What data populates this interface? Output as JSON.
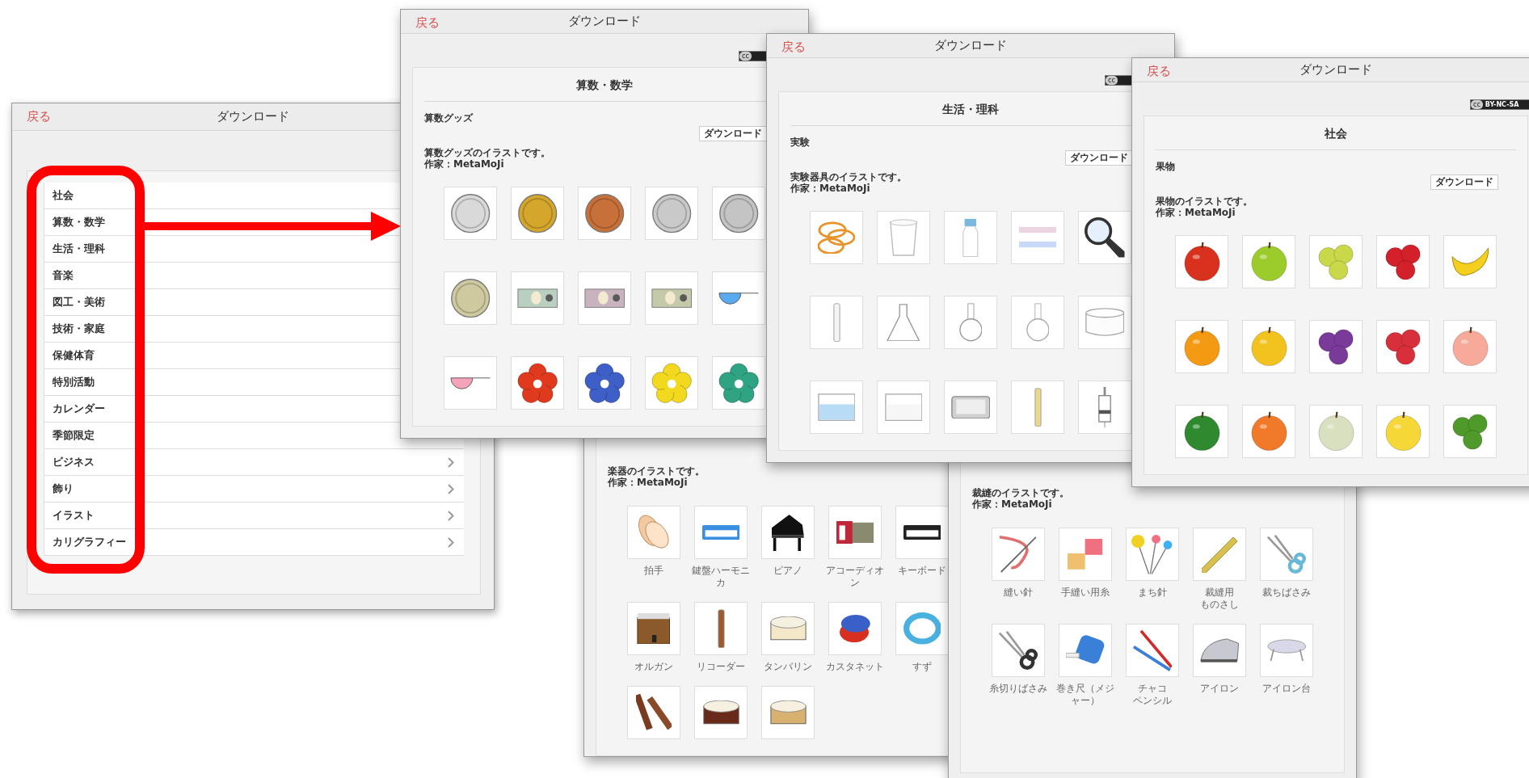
{
  "list_window": {
    "back": "戻る",
    "title": "ダウンロード",
    "items": [
      {
        "label": "社会",
        "chevron": false
      },
      {
        "label": "算数・数学",
        "chevron": false
      },
      {
        "label": "生活・理科",
        "chevron": false
      },
      {
        "label": "音楽",
        "chevron": false
      },
      {
        "label": "図工・美術",
        "chevron": false
      },
      {
        "label": "技術・家庭",
        "chevron": false
      },
      {
        "label": "保健体育",
        "chevron": false
      },
      {
        "label": "特別活動",
        "chevron": false
      },
      {
        "label": "カレンダー",
        "chevron": false
      },
      {
        "label": "季節限定",
        "chevron": false
      },
      {
        "label": "ビジネス",
        "chevron": true
      },
      {
        "label": "飾り",
        "chevron": true
      },
      {
        "label": "イラスト",
        "chevron": true
      },
      {
        "label": "カリグラフィー",
        "chevron": true
      }
    ]
  },
  "windows": [
    {
      "back": "戻る",
      "title": "ダウンロード",
      "license": {
        "mark": "cc"
      },
      "category": "算数・数学",
      "section": "算数グッズ",
      "download": "ダウンロード",
      "description": "算数グッズのイラストです。",
      "author": "作家：MetaMoJi",
      "tiles": [
        {
          "kind": "coin",
          "color": "#d9d9d9"
        },
        {
          "kind": "coin",
          "color": "#d4a72c"
        },
        {
          "kind": "coin",
          "color": "#c8703a"
        },
        {
          "kind": "coin",
          "color": "#c9c9c9"
        },
        {
          "kind": "coin",
          "color": "#c4c4c4"
        },
        {
          "kind": "coin",
          "color": "#cfc9a0"
        },
        {
          "kind": "bill",
          "color": "#b9cfc0"
        },
        {
          "kind": "bill",
          "color": "#c9b3bf"
        },
        {
          "kind": "bill",
          "color": "#c3c9a9"
        },
        {
          "kind": "scoop",
          "color": "#5aaaf0"
        },
        {
          "kind": "scoop",
          "color": "#f4a3b8"
        },
        {
          "kind": "flower",
          "color": "#e03a1e"
        },
        {
          "kind": "flower",
          "color": "#3f5fc8"
        },
        {
          "kind": "flower",
          "color": "#f2d81e"
        },
        {
          "kind": "flower",
          "color": "#2fa383"
        }
      ]
    },
    {
      "back": "戻る",
      "title": "ダウンロード",
      "license": {
        "mark": "cc"
      },
      "category": "生活・理科",
      "section": "実験",
      "download": "ダウンロード",
      "description": "実験器具のイラストです。",
      "author": "作家：MetaMoJi",
      "tiles": [
        {
          "kind": "bands",
          "color": "#e8922a"
        },
        {
          "kind": "cup",
          "color": "#bbbbbb"
        },
        {
          "kind": "bottle",
          "color": "#7ab8e0"
        },
        {
          "kind": "strips",
          "color": "#c8d8f8"
        },
        {
          "kind": "magnifier",
          "color": "#333333"
        },
        {
          "kind": "stick",
          "color": "#f4f4f4"
        },
        {
          "kind": "flask",
          "color": "#999999"
        },
        {
          "kind": "roundflask",
          "color": "#999999"
        },
        {
          "kind": "roundflask",
          "color": "#aaaaaa"
        },
        {
          "kind": "dish",
          "color": "#aaaaaa"
        },
        {
          "kind": "tank",
          "color": "#b8dcf5"
        },
        {
          "kind": "tank",
          "color": "#f6f6f6"
        },
        {
          "kind": "tray",
          "color": "#d0d0d0"
        },
        {
          "kind": "stick",
          "color": "#e8d890"
        },
        {
          "kind": "syringe",
          "color": "#888888"
        }
      ]
    },
    {
      "back": "戻る",
      "title": "ダウンロード",
      "license": {
        "mark": "cc",
        "label": "BY-NC-SA"
      },
      "category": "社会",
      "section": "果物",
      "download": "ダウンロード",
      "description": "果物のイラストです。",
      "author": "作家：MetaMoJi",
      "tiles": [
        {
          "kind": "fruit",
          "color": "#d8321e"
        },
        {
          "kind": "fruit",
          "color": "#9ccc2c"
        },
        {
          "kind": "berries",
          "color": "#c8d848"
        },
        {
          "kind": "berries",
          "color": "#d4202a"
        },
        {
          "kind": "banana",
          "color": "#f5cf1e"
        },
        {
          "kind": "fruit",
          "color": "#f39a12"
        },
        {
          "kind": "fruit",
          "color": "#f2c21e"
        },
        {
          "kind": "berries",
          "color": "#7a3a9a"
        },
        {
          "kind": "berries",
          "color": "#d8303a"
        },
        {
          "kind": "fruit",
          "color": "#f7a99a"
        },
        {
          "kind": "fruit",
          "color": "#2f8a2f"
        },
        {
          "kind": "fruit",
          "color": "#f07a2a"
        },
        {
          "kind": "fruit",
          "color": "#d8e0c0"
        },
        {
          "kind": "fruit",
          "color": "#f5d838"
        },
        {
          "kind": "berries",
          "color": "#4f9a2a"
        }
      ]
    },
    {
      "description": "楽器のイラストです。",
      "author": "作家：MetaMoJi",
      "tiles": [
        {
          "kind": "hands",
          "color": "#f2c9a0",
          "lines": [
            "拍手"
          ]
        },
        {
          "kind": "keyboard",
          "color": "#3a8fe0",
          "lines": [
            "鍵盤ハーモニカ"
          ]
        },
        {
          "kind": "piano",
          "color": "#111111",
          "lines": [
            "ピアノ"
          ]
        },
        {
          "kind": "accordion",
          "color": "#c0283a",
          "lines": [
            "アコーディオン"
          ]
        },
        {
          "kind": "keyboard",
          "color": "#222222",
          "lines": [
            "キーボード"
          ]
        },
        {
          "kind": "organ",
          "color": "#8a5a2a",
          "lines": [
            "オルガン"
          ]
        },
        {
          "kind": "stick",
          "color": "#9a5a2a",
          "lines": [
            "リコーダー"
          ]
        },
        {
          "kind": "drum",
          "color": "#f5e8c8",
          "lines": [
            "タンバリン"
          ]
        },
        {
          "kind": "castanet",
          "color": "#3a60c8",
          "lines": [
            "カスタネット"
          ]
        },
        {
          "kind": "bellring",
          "color": "#4ab0e0",
          "lines": [
            "すず"
          ]
        },
        {
          "kind": "sticks",
          "color": "#7a3a20"
        },
        {
          "kind": "drum",
          "color": "#6a2a1a"
        },
        {
          "kind": "drum",
          "color": "#d8b070"
        }
      ]
    },
    {
      "description": "裁縫のイラストです。",
      "author": "作家：MetaMoJi",
      "tiles": [
        {
          "kind": "needle",
          "color": "#e07070",
          "lines": [
            "縫い針"
          ]
        },
        {
          "kind": "thread",
          "color": "#f07080",
          "lines": [
            "手縫い用糸"
          ]
        },
        {
          "kind": "pins",
          "color": "#f0d020",
          "lines": [
            "まち針"
          ]
        },
        {
          "kind": "ruler",
          "color": "#d8c050",
          "lines": [
            "裁縫用",
            "ものさし"
          ]
        },
        {
          "kind": "scissors",
          "color": "#6ab8d8",
          "lines": [
            "裁ちばさみ"
          ]
        },
        {
          "kind": "scissors",
          "color": "#333333",
          "lines": [
            "糸切りばさみ"
          ]
        },
        {
          "kind": "tape",
          "color": "#3a80d8",
          "lines": [
            "巻き尺（メジャー）"
          ]
        },
        {
          "kind": "pencil",
          "color": "#d02a2a",
          "lines": [
            "チャコ",
            "ペンシル"
          ]
        },
        {
          "kind": "iron",
          "color": "#c8c8d0",
          "lines": [
            "アイロン"
          ]
        },
        {
          "kind": "board",
          "color": "#d8d8e8",
          "lines": [
            "アイロン台"
          ]
        }
      ]
    }
  ]
}
